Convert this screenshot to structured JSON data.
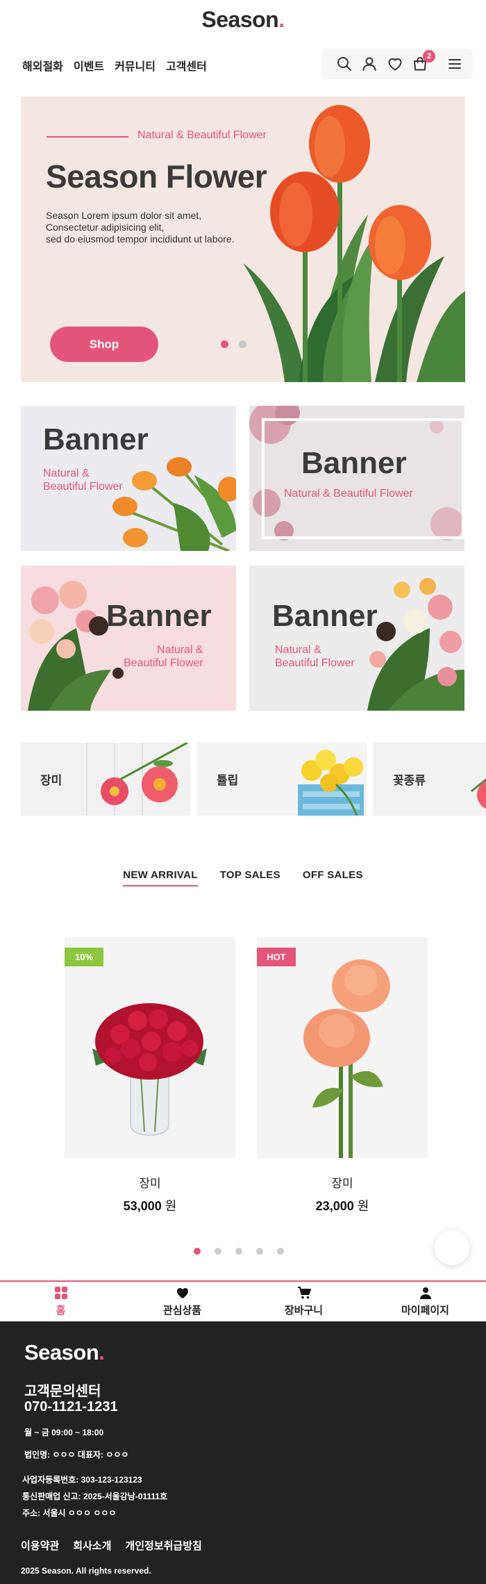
{
  "header": {
    "logo_text": "Season",
    "logo_dot": ".",
    "nav": [
      "해외절화",
      "이벤트",
      "커뮤니티",
      "고객센터"
    ],
    "cart_count": "2",
    "icons": [
      "search-icon",
      "user-icon",
      "heart-icon",
      "shopping-bag-icon",
      "hamburger-menu-icon"
    ]
  },
  "hero": {
    "kicker": "Natural & Beautiful Flower",
    "title": "Season Flower",
    "description": "Season Lorem ipsum dolor sit amet,\n Consectetur adipisicing elit,\nsed do eiusmod tempor incididunt ut labore.",
    "button": "Shop",
    "slide_count": 2,
    "active_slide": 1
  },
  "banners": [
    {
      "title": "Banner",
      "subtitle": "Natural &\nBeautiful Flower"
    },
    {
      "title": "Banner",
      "subtitle": "Natural & Beautiful Flower"
    },
    {
      "title": "Banner",
      "subtitle": "Natural &\nBeautiful Flower"
    },
    {
      "title": "Banner",
      "subtitle": "Natural &\nBeautiful Flower"
    }
  ],
  "categories": [
    "장미",
    "튤립",
    "꽃종류"
  ],
  "tabs": {
    "items": [
      "NEW ARRIVAL",
      "TOP SALES",
      "OFF SALES"
    ],
    "active": 0
  },
  "products": [
    {
      "badge": "10%",
      "badge_color": "#8dc63f",
      "name": "장미",
      "price": "53,000",
      "currency": "원"
    },
    {
      "badge": "HOT",
      "badge_color": "#e4557a",
      "name": "장미",
      "price": "23,000",
      "currency": "원"
    }
  ],
  "product_pager": {
    "count": 5,
    "active": 0
  },
  "bottom_nav": [
    {
      "label": "홈",
      "icon": "grid-home-icon",
      "active": true
    },
    {
      "label": "관심상품",
      "icon": "heart-icon",
      "active": false
    },
    {
      "label": "장바구니",
      "icon": "cart-icon",
      "active": false
    },
    {
      "label": "마이페이지",
      "icon": "person-icon",
      "active": false
    }
  ],
  "footer": {
    "logo_text": "Season",
    "logo_dot": ".",
    "cs_title": "고객문의센터",
    "phone": "070-1121-1231",
    "hours": "월 ~ 금 09:00 ~ 18:00",
    "corp": "법인명: ㅇㅇㅇ 대표자: ㅇㅇㅇ",
    "biz_no": "사업자등록번호: 303-123-123123",
    "ecommerce": "통신판매업 신고: 2025-서울강남-01111호",
    "address": "주소: 서울시 ㅇㅇㅇ ㅇㅇㅇ",
    "links": [
      "이용약관",
      "회사소개",
      "개인정보취급방침"
    ],
    "copyright": "2025 Season. All rights reserved."
  },
  "colors": {
    "accent": "#e4557a",
    "footer_bg": "#222222",
    "hero_bg": "#f4e7e1"
  }
}
